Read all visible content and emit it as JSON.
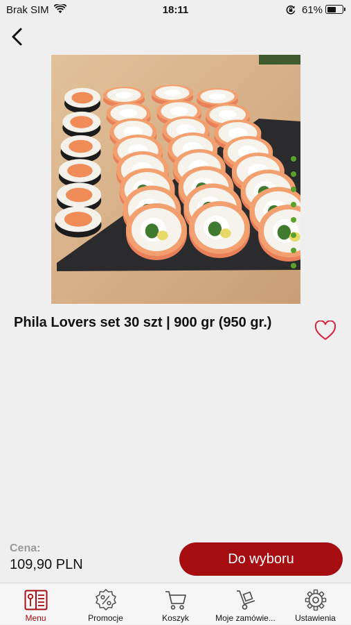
{
  "status_bar": {
    "carrier": "Brak SIM",
    "time": "18:11",
    "battery_percent": "61%",
    "battery_level": 0.61
  },
  "product": {
    "title": "Phila Lovers set 30 szt | 900 gr (950 gr.)",
    "image_icon": "sushi-set-photo",
    "favorite_icon": "heart-outline-icon"
  },
  "purchase": {
    "price_label": "Cena:",
    "price_value": "109,90 PLN",
    "cta_label": "Do wyboru"
  },
  "tabbar": {
    "active_color": "#a50d10",
    "items": [
      {
        "label": "Menu",
        "icon": "menu-book-icon",
        "active": true
      },
      {
        "label": "Promocje",
        "icon": "percent-badge-icon",
        "active": false
      },
      {
        "label": "Koszyk",
        "icon": "cart-icon",
        "active": false
      },
      {
        "label": "Moje zamówie...",
        "icon": "hand-truck-icon",
        "active": false
      },
      {
        "label": "Ustawienia",
        "icon": "gear-icon",
        "active": false
      }
    ]
  },
  "colors": {
    "accent": "#a50d10",
    "background": "#efefef",
    "favorite": "#d61f3a"
  }
}
